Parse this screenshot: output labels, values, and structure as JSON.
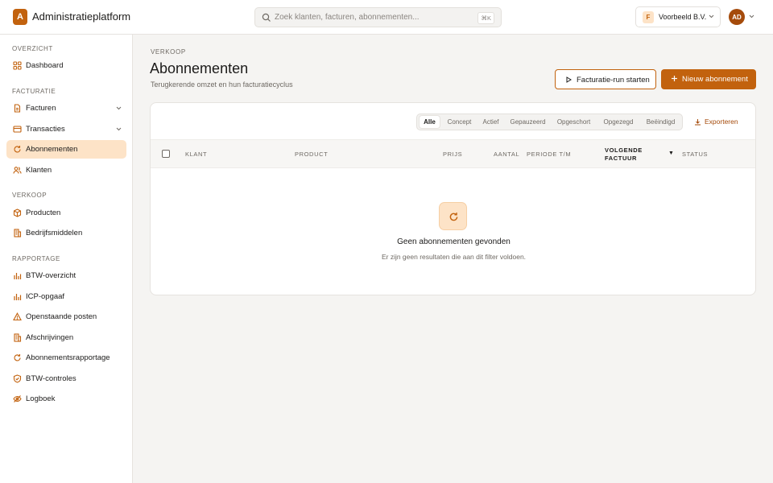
{
  "app": {
    "logo_letter": "A",
    "title": "Administratieplatform"
  },
  "search": {
    "placeholder": "Zoek klanten, facturen, abonnementen...",
    "shortcut": "⌘K"
  },
  "org": {
    "badge": "F",
    "name": "Voorbeeld B.V."
  },
  "user": {
    "initials": "AD"
  },
  "sidebar": {
    "sections": [
      {
        "label": "OVERZICHT",
        "items": [
          {
            "label": "Dashboard",
            "icon": "grid-icon"
          }
        ]
      },
      {
        "label": "FACTURATIE",
        "items": [
          {
            "label": "Facturen",
            "icon": "document-icon",
            "expandable": true
          },
          {
            "label": "Transacties",
            "icon": "card-icon",
            "expandable": true
          },
          {
            "label": "Abonnementen",
            "icon": "refresh-icon",
            "active": true
          },
          {
            "label": "Klanten",
            "icon": "users-icon"
          }
        ]
      },
      {
        "label": "VERKOOP",
        "items": [
          {
            "label": "Producten",
            "icon": "box-icon"
          },
          {
            "label": "Bedrijfsmiddelen",
            "icon": "building-icon"
          }
        ]
      },
      {
        "label": "RAPPORTAGE",
        "items": [
          {
            "label": "BTW-overzicht",
            "icon": "bar-chart-icon"
          },
          {
            "label": "ICP-opgaaf",
            "icon": "bar-chart-icon"
          },
          {
            "label": "Openstaande posten",
            "icon": "warning-icon"
          },
          {
            "label": "Afschrijvingen",
            "icon": "building-icon"
          },
          {
            "label": "Abonnementsrapportage",
            "icon": "refresh-icon"
          },
          {
            "label": "BTW-controles",
            "icon": "shield-icon"
          },
          {
            "label": "Logboek",
            "icon": "eye-off-icon"
          }
        ]
      }
    ]
  },
  "page": {
    "breadcrumb": "VERKOOP",
    "title": "Abonnementen",
    "subtitle": "Terugkerende omzet en hun facturatiecyclus",
    "btn_run": "Facturatie-run starten",
    "btn_new": "Nieuw abonnement"
  },
  "filters": [
    "Alle",
    "Concept",
    "Actief",
    "Gepauzeerd",
    "Opgeschort",
    "Opgezegd",
    "Beëindigd"
  ],
  "active_filter": "Alle",
  "export_label": "Exporteren",
  "table": {
    "columns": {
      "klant": "KLANT",
      "product": "PRODUCT",
      "prijs": "PRIJS",
      "aantal": "AANTAL",
      "periode": "PERIODE T/M",
      "volgende_1": "VOLGENDE",
      "volgende_2": "FACTUUR",
      "status": "STATUS"
    },
    "sort_indicator": "▼"
  },
  "empty": {
    "title": "Geen abonnementen gevonden",
    "subtitle": "Er zijn geen resultaten die aan dit filter voldoen."
  },
  "colors": {
    "accent": "#c2620e",
    "accent_light": "#fde3c7"
  }
}
